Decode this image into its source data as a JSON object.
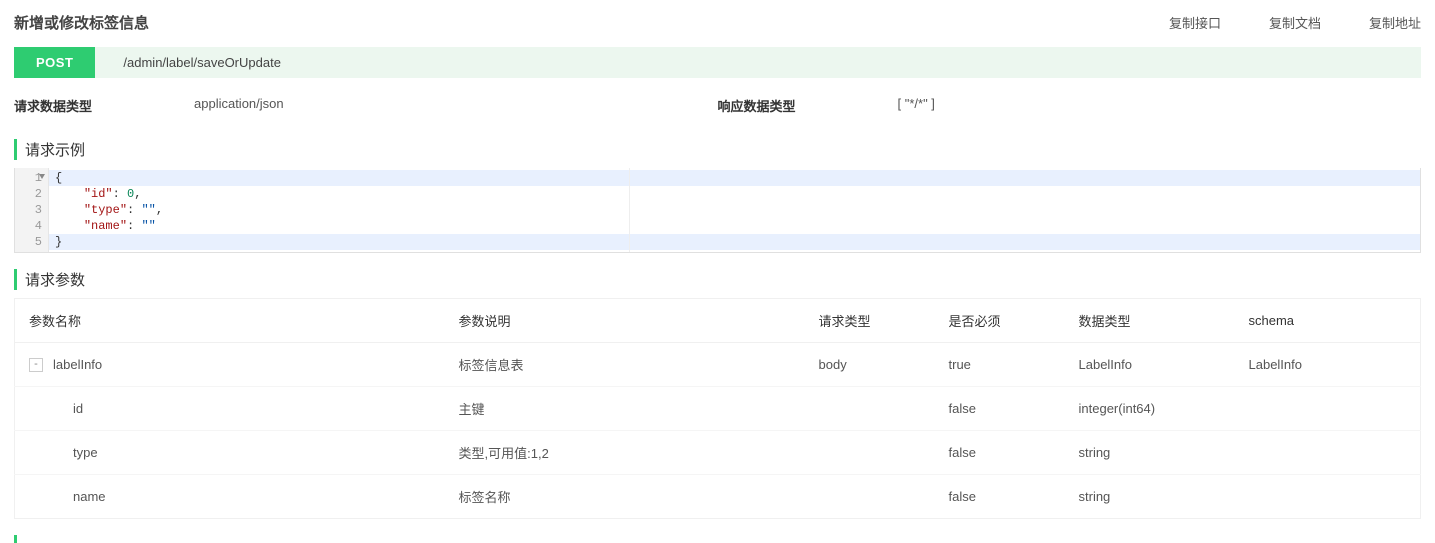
{
  "header": {
    "title": "新增或修改标签信息",
    "actions": {
      "copy_api": "复制接口",
      "copy_doc": "复制文档",
      "copy_url": "复制地址"
    }
  },
  "endpoint": {
    "method": "POST",
    "path": "/admin/label/saveOrUpdate"
  },
  "meta": {
    "request_type_label": "请求数据类型",
    "request_type_value": "application/json",
    "response_type_label": "响应数据类型",
    "response_type_value": "[ \"*/*\" ]"
  },
  "sections": {
    "example_title": "请求示例",
    "params_title": "请求参数"
  },
  "example_code": {
    "lines": [
      {
        "n": "1",
        "raw": "{"
      },
      {
        "n": "2",
        "raw": "    \"id\": 0,"
      },
      {
        "n": "3",
        "raw": "    \"type\": \"\","
      },
      {
        "n": "4",
        "raw": "    \"name\": \"\""
      },
      {
        "n": "5",
        "raw": "}"
      }
    ]
  },
  "params_table": {
    "headers": {
      "name": "参数名称",
      "desc": "参数说明",
      "reqtype": "请求类型",
      "required": "是否必须",
      "datatype": "数据类型",
      "schema": "schema"
    },
    "rows": [
      {
        "name": "labelInfo",
        "desc": "标签信息表",
        "reqtype": "body",
        "required": "true",
        "datatype": "LabelInfo",
        "schema": "LabelInfo",
        "expandable": true,
        "level": 0
      },
      {
        "name": "id",
        "desc": "主键",
        "reqtype": "",
        "required": "false",
        "datatype": "integer(int64)",
        "schema": "",
        "level": 1
      },
      {
        "name": "type",
        "desc": "类型,可用值:1,2",
        "reqtype": "",
        "required": "false",
        "datatype": "string",
        "schema": "",
        "level": 1
      },
      {
        "name": "name",
        "desc": "标签名称",
        "reqtype": "",
        "required": "false",
        "datatype": "string",
        "schema": "",
        "level": 1
      }
    ]
  },
  "expand_glyph": "-"
}
